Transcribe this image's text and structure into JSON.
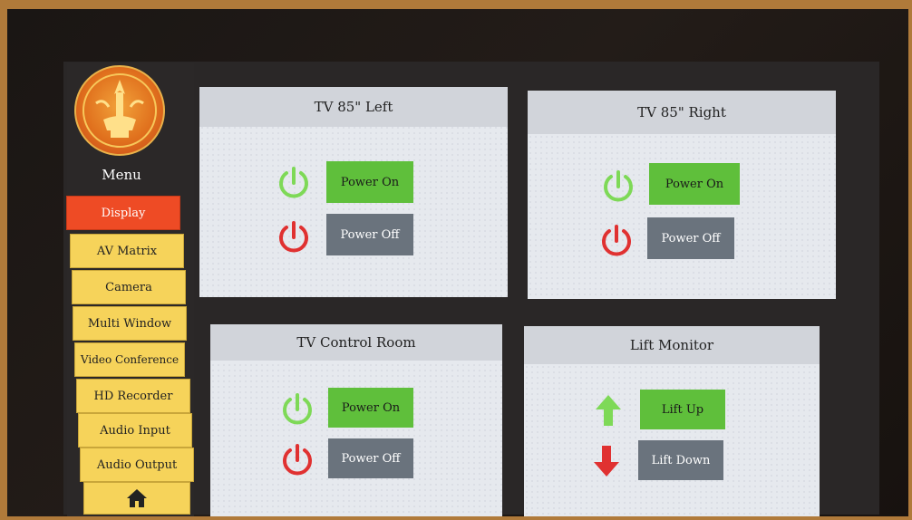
{
  "menu": {
    "title": "Menu",
    "items": [
      {
        "label": "Display",
        "active": true
      },
      {
        "label": "AV Matrix",
        "active": false
      },
      {
        "label": "Camera",
        "active": false
      },
      {
        "label": "Multi Window",
        "active": false
      },
      {
        "label": "Video Conference",
        "active": false
      },
      {
        "label": "HD Recorder",
        "active": false
      },
      {
        "label": "Audio Input",
        "active": false
      },
      {
        "label": "Audio Output",
        "active": false
      }
    ],
    "home_icon": "home-icon"
  },
  "panels": {
    "tv_left": {
      "title": "TV 85\" Left",
      "on_label": "Power On",
      "off_label": "Power Off"
    },
    "tv_right": {
      "title": "TV 85\" Right",
      "on_label": "Power On",
      "off_label": "Power Off"
    },
    "tv_control": {
      "title": "TV Control Room",
      "on_label": "Power On",
      "off_label": "Power Off"
    },
    "lift": {
      "title": "Lift Monitor",
      "up_label": "Lift Up",
      "down_label": "Lift Down"
    }
  },
  "colors": {
    "active_menu": "#ee4b25",
    "menu_item": "#f6d35a",
    "power_on": "#5fbf3b",
    "power_off": "#6a737d",
    "icon_green": "#7ed957",
    "icon_red": "#e03131"
  }
}
